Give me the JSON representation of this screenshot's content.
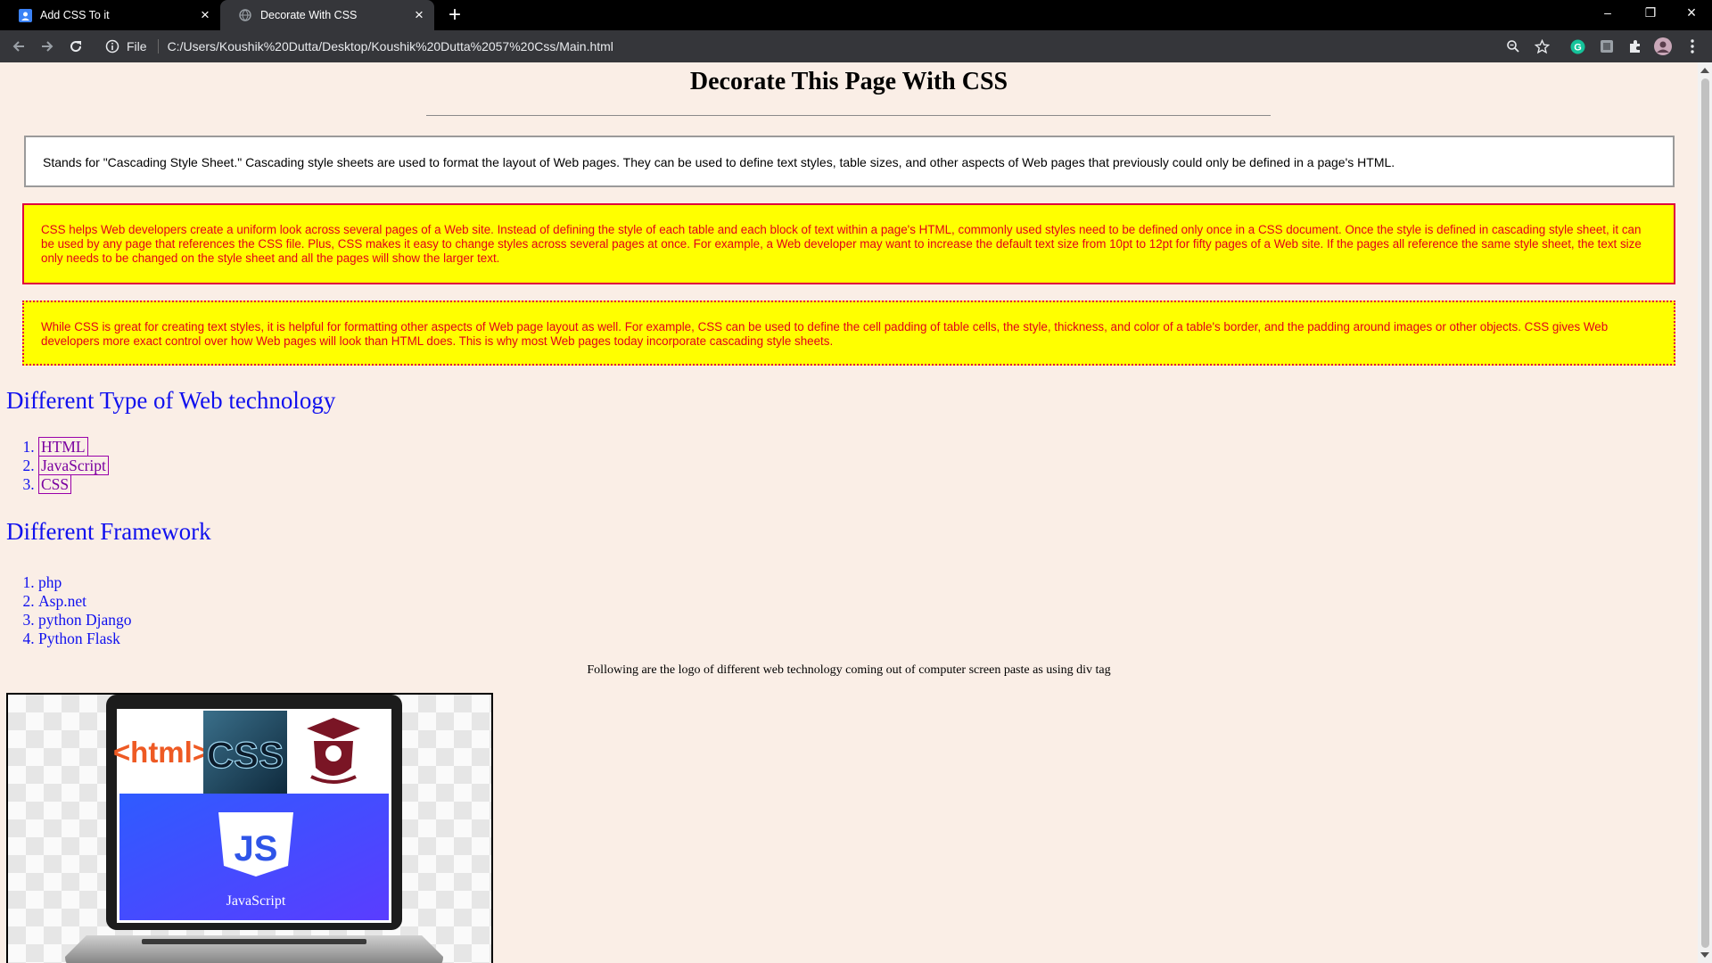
{
  "browser": {
    "tabs": [
      {
        "title": "Add CSS To it",
        "active": false
      },
      {
        "title": "Decorate With CSS",
        "active": true
      }
    ],
    "url": "C:/Users/Koushik%20Dutta/Desktop/Koushik%20Dutta%2057%20Css/Main.html",
    "url_scheme_label": "File"
  },
  "page": {
    "heading": "Decorate This Page With CSS",
    "para1": "Stands for \"Cascading Style Sheet.\" Cascading style sheets are used to format the layout of Web pages. They can be used to define text styles, table sizes, and other aspects of Web pages that previously could only be defined in a page's HTML.",
    "para2": "CSS helps Web developers create a uniform look across several pages of a Web site. Instead of defining the style of each table and each block of text within a page's HTML, commonly used styles need to be defined only once in a CSS document. Once the style is defined in cascading style sheet, it can be used by any page that references the CSS file. Plus, CSS makes it easy to change styles across several pages at once. For example, a Web developer may want to increase the default text size from 10pt to 12pt for fifty pages of a Web site. If the pages all reference the same style sheet, the text size only needs to be changed on the style sheet and all the pages will show the larger text.",
    "para3": "While CSS is great for creating text styles, it is helpful for formatting other aspects of Web page layout as well. For example, CSS can be used to define the cell padding of table cells, the style, thickness, and color of a table's border, and the padding around images or other objects. CSS gives Web developers more exact control over how Web pages will look than HTML does. This is why most Web pages today incorporate cascading style sheets.",
    "section1_title": "Different Type of Web technology",
    "technologies": [
      "HTML",
      "JavaScript",
      "CSS"
    ],
    "section2_title": "Different Framework",
    "frameworks": [
      "php",
      "Asp.net",
      "python Django",
      "Python Flask"
    ],
    "caption": "Following are the logo of different web technology coming out of computer screen paste as using div tag",
    "image": {
      "logo_html": "<html>",
      "logo_css": "CSS",
      "logo_js": "JS",
      "logo_js_label": "JavaScript"
    }
  },
  "colors": {
    "page_bg": "#faeee6",
    "heading_blue": "#1010ee",
    "highlight_yellow": "#ffff00",
    "alert_red": "#e2001a"
  }
}
